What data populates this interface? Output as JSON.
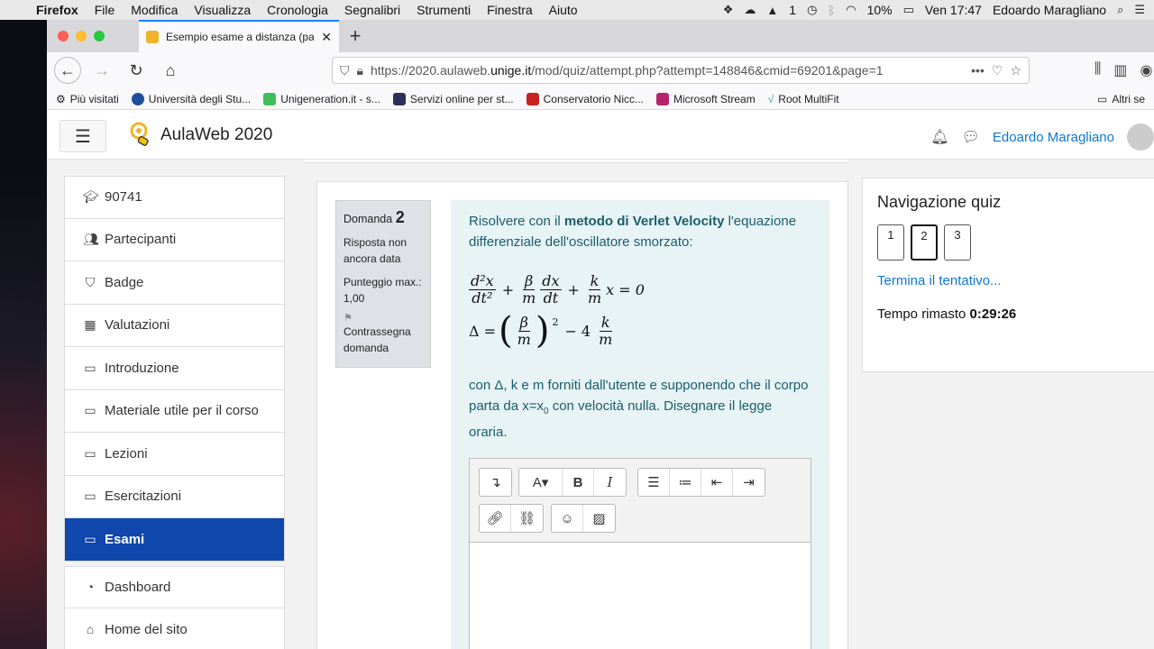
{
  "menubar": {
    "app": "Firefox",
    "items": [
      "File",
      "Modifica",
      "Visualizza",
      "Cronologia",
      "Segnalibri",
      "Strumenti",
      "Finestra",
      "Aiuto"
    ],
    "status": {
      "adobe_count": "1",
      "battery": "10%",
      "clock": "Ven 17:47",
      "user": "Edoardo Maragliano"
    }
  },
  "browser": {
    "tab_title": "Esempio esame a distanza (pag",
    "url_prefix": "https://2020.aulaweb.",
    "url_domain": "unige.it",
    "url_path": "/mod/quiz/attempt.php?attempt=148846&cmid=69201&page=1",
    "bookmarks": [
      "Più visitati",
      "Università degli Stu...",
      "Unigeneration.it - s...",
      "Servizi online per st...",
      "Conservatorio Nicc...",
      "Microsoft Stream",
      "Root MultiFit"
    ],
    "bookmarks_right": "Altri se",
    "colors": {
      "tab_accent": "#0a84ff"
    }
  },
  "header": {
    "site_name": "AulaWeb 2020",
    "user_name": "Edoardo Maragliano"
  },
  "sidebar": {
    "items": [
      {
        "label": "90741",
        "icon": "graduation-cap-icon"
      },
      {
        "label": "Partecipanti",
        "icon": "users-icon"
      },
      {
        "label": "Badge",
        "icon": "shield-icon"
      },
      {
        "label": "Valutazioni",
        "icon": "table-icon"
      },
      {
        "label": "Introduzione",
        "icon": "folder-icon"
      },
      {
        "label": "Materiale utile per il corso",
        "icon": "folder-icon"
      },
      {
        "label": "Lezioni",
        "icon": "folder-icon"
      },
      {
        "label": "Esercitazioni",
        "icon": "folder-icon"
      },
      {
        "label": "Esami",
        "icon": "folder-icon",
        "active": true
      }
    ],
    "items2": [
      {
        "label": "Dashboard",
        "icon": "dashboard-icon"
      },
      {
        "label": "Home del sito",
        "icon": "home-icon"
      }
    ],
    "colors": {
      "active": "#0f47ad"
    }
  },
  "question": {
    "label": "Domanda",
    "number": "2",
    "status": "Risposta non ancora data",
    "grade": "Punteggio max.: 1,00",
    "flag": "Contrassegna domanda",
    "text_pre": "Risolvere con il ",
    "text_bold": "metodo di Verlet Velocity",
    "text_post": " l'equazione differenziale dell'oscillatore smorzato:",
    "text2_pre": "con  Δ, k e m forniti dall'utente e supponendo che il corpo parta da x=x",
    "text2_sub": "0",
    "text2_post": " con velocità nulla. Disegnare il legge oraria.",
    "equation": {
      "d2x": "d²x",
      "dt2": "dt²",
      "beta": "β",
      "m": "m",
      "dx": "dx",
      "dt": "dt",
      "k": "k",
      "plus": "+",
      "x_eq0": "x = 0",
      "delta_eq": "Δ =",
      "sq": "2",
      "minus4": "− 4"
    },
    "colors": {
      "content_bg": "#e7f3f5",
      "info_bg": "#dee2e6"
    }
  },
  "quiznav": {
    "title": "Navigazione quiz",
    "pages": [
      "1",
      "2",
      "3"
    ],
    "current_page": "2",
    "finish_link": "Termina il tentativo...",
    "timer_label": "Tempo rimasto ",
    "timer_value": "0:29:26"
  }
}
